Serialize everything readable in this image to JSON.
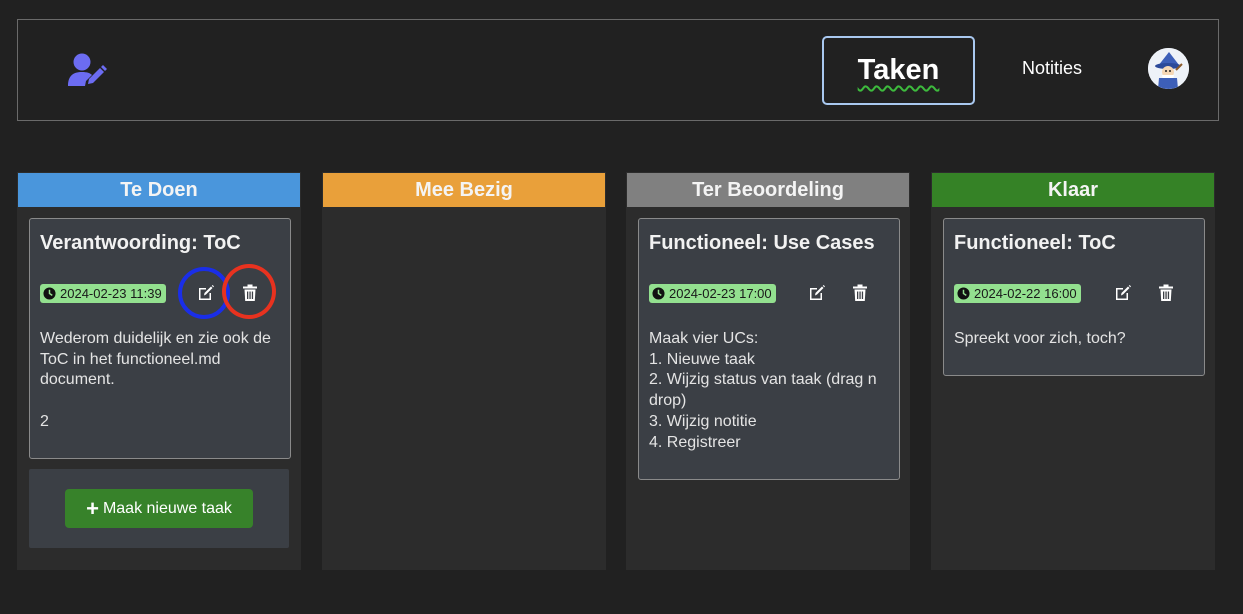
{
  "colors": {
    "te_doen": "#4a96dc",
    "mee_bezig": "#e9a03a",
    "ter_beoordeling": "#808080",
    "klaar": "#358226",
    "date_badge": "#93e08f",
    "button": "#37822a"
  },
  "header": {
    "user_icon": "user-edit-icon",
    "nav": {
      "taken": "Taken",
      "notities": "Notities"
    },
    "avatar": "avatar-icon"
  },
  "columns": {
    "te_doen": {
      "title": "Te Doen",
      "cards": [
        {
          "title": "Verantwoording: ToC",
          "date": "2024-02-23 11:39",
          "body": "Wederom duidelijk en zie ook de ToC in het functioneel.md document.\n\n2"
        }
      ],
      "new_task_label": "Maak nieuwe taak"
    },
    "mee_bezig": {
      "title": "Mee Bezig",
      "cards": []
    },
    "ter_beoordeling": {
      "title": "Ter Beoordeling",
      "cards": [
        {
          "title": "Functioneel: Use Cases",
          "date": "2024-02-23 17:00",
          "body": "Maak vier UCs:\n1. Nieuwe taak\n2. Wijzig status van taak (drag n drop)\n3. Wijzig notitie\n4. Registreer"
        }
      ]
    },
    "klaar": {
      "title": "Klaar",
      "cards": [
        {
          "title": "Functioneel: ToC",
          "date": "2024-02-22 16:00",
          "body": "Spreekt voor zich, toch?"
        }
      ]
    }
  }
}
